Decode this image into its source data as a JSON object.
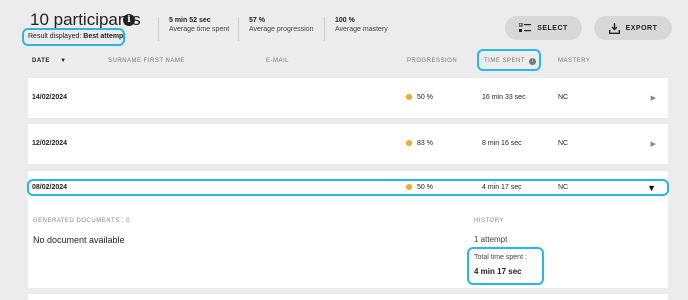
{
  "header": {
    "title": "10 participants",
    "result_label_prefix": "Result displayed: ",
    "result_label_value": "Best attempt"
  },
  "stats": [
    {
      "value": "5 min 52 sec",
      "label": "Average time spent"
    },
    {
      "value": "57 %",
      "label": "Average progression"
    },
    {
      "value": "100 %",
      "label": "Average mastery"
    }
  ],
  "buttons": {
    "select": "SELECT",
    "export": "EXPORT"
  },
  "columns": {
    "date": "DATE",
    "name": "SURNAME FIRST NAME",
    "email": "E-MAIL",
    "progression": "PROGRESSION",
    "time_spent": "TIME SPENT",
    "mastery": "MASTERY"
  },
  "rows": [
    {
      "date": "14/02/2024",
      "progression": "50 %",
      "time": "16 min 33 sec",
      "mastery": "NC"
    },
    {
      "date": "12/02/2024",
      "progression": "83 %",
      "time": "8 min 16 sec",
      "mastery": "NC"
    },
    {
      "date": "08/02/2024",
      "progression": "50 %",
      "time": "4 min 17 sec",
      "mastery": "NC"
    }
  ],
  "detail": {
    "documents_heading": "GENERATED DOCUMENTS : 0",
    "documents_empty": "No document available",
    "history_heading": "HISTORY",
    "attempts": "1 attempt",
    "total_label": "Total time spent :",
    "total_value": "4 min 17 sec"
  },
  "colors": {
    "highlight": "#29b6e8",
    "progress_dot": "#f5a623"
  },
  "icons": {
    "info": "info-icon",
    "select": "select-list-icon",
    "export": "download-icon",
    "sort": "sort-down-icon",
    "expand": "chevron-right-icon",
    "collapse": "chevron-down-icon"
  }
}
